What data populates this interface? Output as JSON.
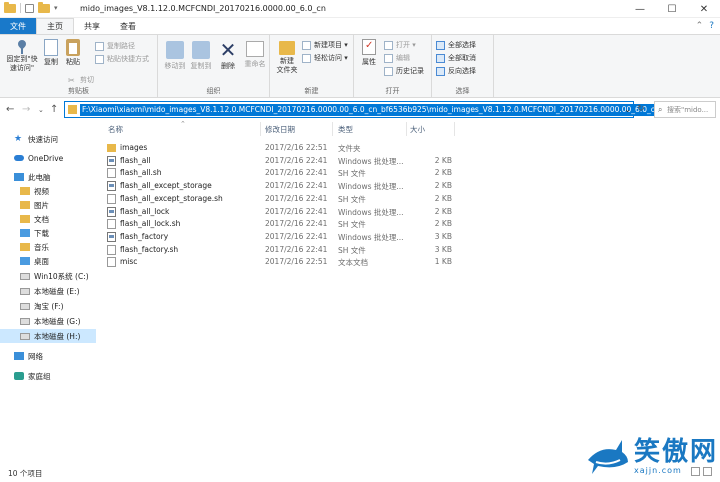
{
  "window": {
    "title": "mido_images_V8.1.12.0.MCFCNDI_20170216.0000.00_6.0_cn",
    "controls": {
      "minimize": "—",
      "maximize": "☐",
      "close": "✕"
    }
  },
  "ribbon_tabs": [
    "文件",
    "主页",
    "共享",
    "查看"
  ],
  "ribbon": {
    "clipboard": {
      "pin": "固定到\"快\n速访问\"",
      "copy": "复制",
      "paste": "粘贴",
      "cut": "剪切",
      "copy_path": "复制路径",
      "paste_shortcut": "粘贴快捷方式",
      "label": "剪贴板"
    },
    "organize": {
      "move_to": "移动到",
      "copy_to": "复制到",
      "delete": "删除",
      "rename": "重命名",
      "label": "组织"
    },
    "new": {
      "new_folder": "新建\n文件夹",
      "new_item": "新建项目 ▾",
      "easy_access": "轻松访问 ▾",
      "label": "新建"
    },
    "open": {
      "properties": "属性",
      "open": "打开 ▾",
      "edit": "编辑",
      "history": "历史记录",
      "label": "打开"
    },
    "select": {
      "select_all": "全部选择",
      "select_none": "全部取消",
      "invert": "反向选择",
      "label": "选择"
    }
  },
  "address": {
    "path": "F:\\Xiaomi\\xiaomi\\mido_images_V8.1.12.0.MCFCNDI_20170216.0000.00_6.0_cn_bf6536b925\\mido_images_V8.1.12.0.MCFCNDI_20170216.0000.00_6.0_cn",
    "search_placeholder": "搜索\"mido..."
  },
  "sidebar": [
    {
      "label": "快速访问",
      "icon": "star"
    },
    {
      "label": "OneDrive",
      "icon": "cloud"
    },
    {
      "label": "此电脑",
      "icon": "pc"
    },
    {
      "label": "视频",
      "icon": "folder"
    },
    {
      "label": "图片",
      "icon": "folder"
    },
    {
      "label": "文档",
      "icon": "folder"
    },
    {
      "label": "下载",
      "icon": "blue"
    },
    {
      "label": "音乐",
      "icon": "folder"
    },
    {
      "label": "桌面",
      "icon": "blue"
    },
    {
      "label": "Win10系统 (C:)",
      "icon": "drive"
    },
    {
      "label": "本地磁盘 (E:)",
      "icon": "drive"
    },
    {
      "label": "淘宝 (F:)",
      "icon": "drive"
    },
    {
      "label": "本地磁盘 (G:)",
      "icon": "drive"
    },
    {
      "label": "本地磁盘 (H:)",
      "icon": "drive"
    },
    {
      "label": "网络",
      "icon": "net"
    },
    {
      "label": "家庭组",
      "icon": "home"
    }
  ],
  "columns": {
    "name": "名称",
    "date": "修改日期",
    "type": "类型",
    "size": "大小"
  },
  "files": [
    {
      "name": "images",
      "date": "2017/2/16 22:51",
      "type": "文件夹",
      "size": "",
      "icon": "folder"
    },
    {
      "name": "flash_all",
      "date": "2017/2/16 22:41",
      "type": "Windows 批处理...",
      "size": "2 KB",
      "icon": "bat"
    },
    {
      "name": "flash_all.sh",
      "date": "2017/2/16 22:41",
      "type": "SH 文件",
      "size": "2 KB",
      "icon": "txt"
    },
    {
      "name": "flash_all_except_storage",
      "date": "2017/2/16 22:41",
      "type": "Windows 批处理...",
      "size": "2 KB",
      "icon": "bat"
    },
    {
      "name": "flash_all_except_storage.sh",
      "date": "2017/2/16 22:41",
      "type": "SH 文件",
      "size": "2 KB",
      "icon": "txt"
    },
    {
      "name": "flash_all_lock",
      "date": "2017/2/16 22:41",
      "type": "Windows 批处理...",
      "size": "2 KB",
      "icon": "bat"
    },
    {
      "name": "flash_all_lock.sh",
      "date": "2017/2/16 22:41",
      "type": "SH 文件",
      "size": "2 KB",
      "icon": "txt"
    },
    {
      "name": "flash_factory",
      "date": "2017/2/16 22:41",
      "type": "Windows 批处理...",
      "size": "3 KB",
      "icon": "bat"
    },
    {
      "name": "flash_factory.sh",
      "date": "2017/2/16 22:41",
      "type": "SH 文件",
      "size": "3 KB",
      "icon": "txt"
    },
    {
      "name": "misc",
      "date": "2017/2/16 22:51",
      "type": "文本文档",
      "size": "1 KB",
      "icon": "txt"
    }
  ],
  "status": "10 个项目",
  "watermark": {
    "text": "笑傲网",
    "sub": "xajjn.com"
  }
}
